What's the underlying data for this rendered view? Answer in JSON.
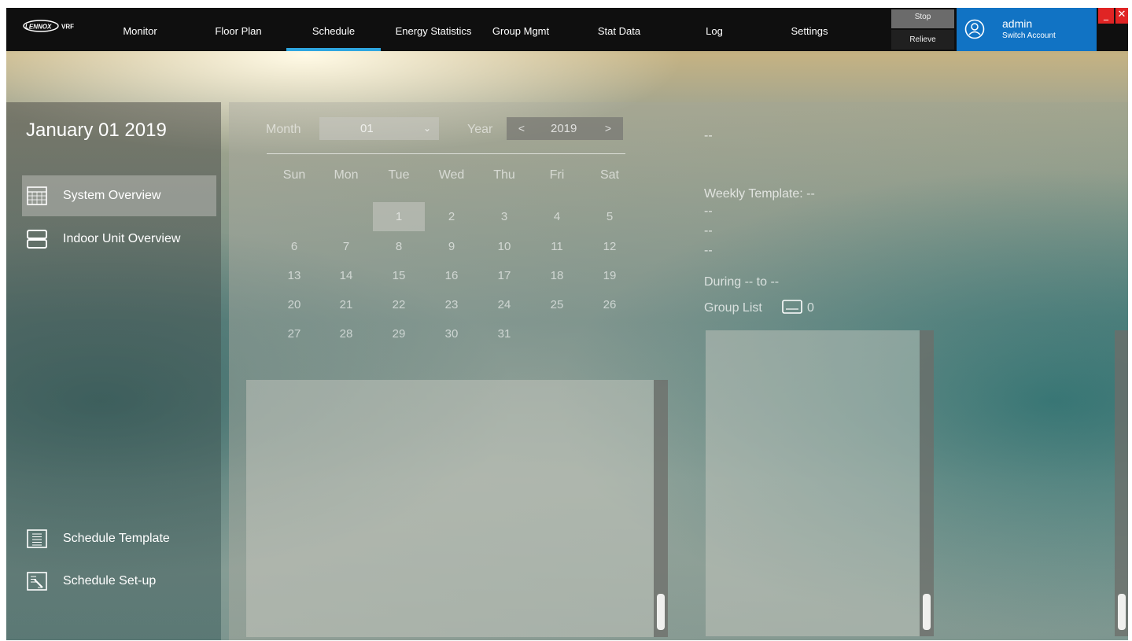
{
  "header": {
    "logo_text": "LENNOX VRF",
    "nav": [
      {
        "label": "Monitor",
        "active": false
      },
      {
        "label": "Floor Plan",
        "active": false
      },
      {
        "label": "Schedule",
        "active": true
      },
      {
        "label": "Energy Statistics",
        "active": false
      },
      {
        "label": "Group Mgmt",
        "active": false
      },
      {
        "label": "Stat Data",
        "active": false
      },
      {
        "label": "Log",
        "active": false
      },
      {
        "label": "Settings",
        "active": false
      }
    ],
    "stop_label": "Stop",
    "relieve_label": "Relieve",
    "user": {
      "name": "admin",
      "switch_label": "Switch Account"
    },
    "minimize_glyph": "_",
    "close_glyph": "✕",
    "accent_color": "#2ea6e0",
    "user_box_color": "#1173c4",
    "window_button_color": "#e02424"
  },
  "sidebar": {
    "date_title": "January 01 2019",
    "items": [
      {
        "label": "System Overview",
        "icon": "calendar-grid-icon",
        "active": true
      },
      {
        "label": "Indoor Unit Overview",
        "icon": "indoor-unit-icon",
        "active": false
      },
      {
        "label": "Schedule Template",
        "icon": "list-document-icon",
        "active": false
      },
      {
        "label": "Schedule Set-up",
        "icon": "edit-document-icon",
        "active": false
      }
    ]
  },
  "calendar": {
    "month_label": "Month",
    "month_value": "01",
    "year_label": "Year",
    "year_value": "2019",
    "prev_glyph": "<",
    "next_glyph": ">",
    "weekdays": [
      "Sun",
      "Mon",
      "Tue",
      "Wed",
      "Thu",
      "Fri",
      "Sat"
    ],
    "first_weekday_index": 2,
    "days_in_month": 31,
    "selected_day": 1
  },
  "details": {
    "header_text": "--",
    "weekly_template": "Weekly Template: --",
    "line1": "--",
    "line2": "--",
    "line3": "--",
    "during": "During  -- to --",
    "group_list_label": "Group List",
    "group_count": "0"
  }
}
